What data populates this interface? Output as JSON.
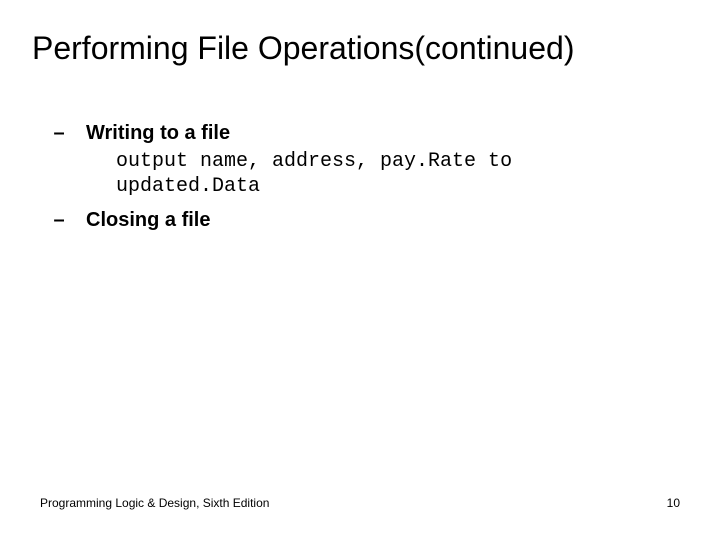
{
  "slide": {
    "title": "Performing File Operations(continued)",
    "bullets": {
      "b1": {
        "dash": "–",
        "label": "Writing to a file",
        "code": "output name, address, pay.Rate to\nupdated.Data"
      },
      "b2": {
        "dash": "–",
        "label": "Closing a file"
      }
    },
    "footer": {
      "book": "Programming Logic & Design, Sixth Edition",
      "page": "10"
    }
  }
}
